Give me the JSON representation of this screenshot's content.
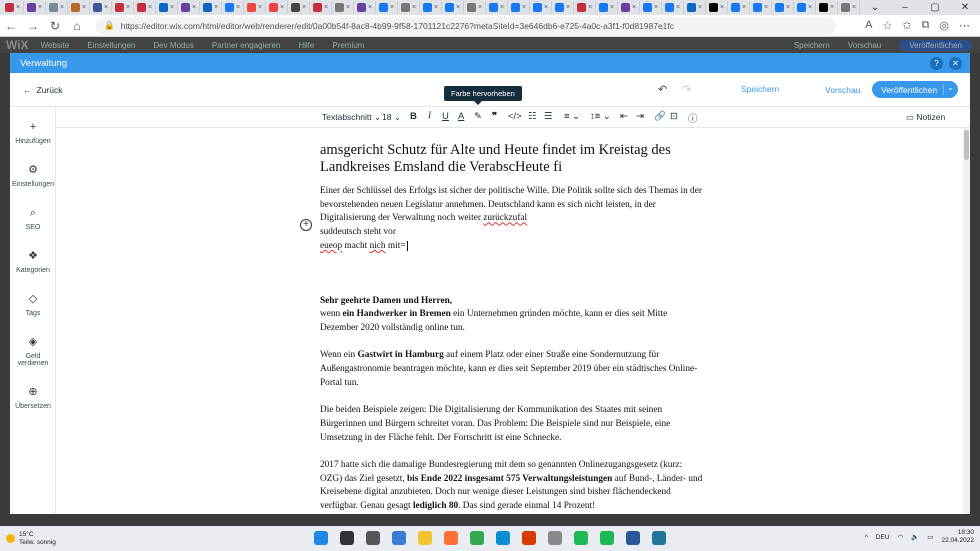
{
  "browser": {
    "tabs": [
      {
        "color": "#c72c41"
      },
      {
        "color": "#6b3fa0"
      },
      {
        "color": "#7a8a99"
      },
      {
        "color": "#b56a2a"
      },
      {
        "color": "#3b5998"
      },
      {
        "color": "#c72c41"
      },
      {
        "color": "#c72c41"
      },
      {
        "color": "#0a66c2"
      },
      {
        "color": "#6b3fa0"
      },
      {
        "color": "#0a66c2"
      },
      {
        "color": "#1877f2"
      },
      {
        "color": "#e44"
      },
      {
        "color": "#e44"
      },
      {
        "color": "#444"
      },
      {
        "color": "#c72c41"
      },
      {
        "color": "#777"
      },
      {
        "color": "#6b3fa0"
      },
      {
        "color": "#1877f2"
      },
      {
        "color": "#777"
      },
      {
        "color": "#1877f2"
      },
      {
        "color": "#1877f2"
      },
      {
        "color": "#777"
      },
      {
        "color": "#1877f2"
      },
      {
        "color": "#1877f2"
      },
      {
        "color": "#1877f2"
      },
      {
        "color": "#1877f2"
      },
      {
        "color": "#c72c41"
      },
      {
        "color": "#1877f2"
      },
      {
        "color": "#6b3fa0"
      },
      {
        "color": "#1877f2"
      },
      {
        "color": "#1877f2"
      },
      {
        "color": "#0a66c2"
      },
      {
        "color": "#000000"
      },
      {
        "color": "#1877f2"
      },
      {
        "color": "#1877f2"
      },
      {
        "color": "#1877f2"
      },
      {
        "color": "#1877f2"
      },
      {
        "color": "#000000"
      },
      {
        "color": "#777"
      },
      {
        "color": "#0a66c2"
      }
    ],
    "active_tab_label": "V",
    "url": "https://editor.wix.com/html/editor/web/renderer/edit/0a00b54f-8ac8-4b99-9f58-1701121c2276?metaSiteId=3e646db6-e725-4a0c-a3f1-f0d81987e1fc"
  },
  "wix_header": {
    "logo": "WiX",
    "menu": [
      "Website",
      "Einstellungen",
      "Dev Modus",
      "Partner engagieren",
      "Hilfe",
      "Premium"
    ],
    "right": [
      "Speichern",
      "Vorschau"
    ],
    "publish": "Veröffentlichen"
  },
  "modal": {
    "title": "Verwaltung",
    "back_label": "Zurück",
    "save_label": "Speichern",
    "preview_label": "Vorschau",
    "publish_label": "Veröffentlichen"
  },
  "sidebar": {
    "items": [
      {
        "label": "Hinzufügen",
        "icon": "plus-icon"
      },
      {
        "label": "Einstellungen",
        "icon": "gear-icon"
      },
      {
        "label": "SEO",
        "icon": "search-icon"
      },
      {
        "label": "Kategorien",
        "icon": "categories-icon"
      },
      {
        "label": "Tags",
        "icon": "tag-icon"
      },
      {
        "label": "Geld verdienen",
        "icon": "money-icon"
      },
      {
        "label": "Übersetzen",
        "icon": "globe-icon"
      }
    ]
  },
  "toolbar": {
    "paragraph_style": "Textabschnitt",
    "font_size": "18",
    "notes_label": "Notizen",
    "tooltip": "Farbe hervorheben"
  },
  "document": {
    "heading": "amsgericht  Schutz für Alte und Heute findet im Kreistag des Landkreises Emsland die VerabscHeute fi",
    "p1_a": "Einer der Schlüssel des Erfolgs ist sicher der politische Wille. Die Politik sollte sich des Themas in der bevorstehenden neuen Legislatur annehmen. Deutschland kann es sich nicht leisten, in der Digitalisierung der Verwaltung noch weiter ",
    "p1_misspelled": "zurückzufal",
    "line2": "suddeutsch steht vor",
    "line3_a": "eueop",
    "line3_b": " macht ",
    "line3_c": "nich",
    "line3_d": " mit=",
    "p2_bold": "Sehr geehrte Damen und Herren,",
    "p2_a": "wenn ",
    "p2_bold2": "ein Handwerker in Bremen",
    "p2_b": " ein Unternehmen gründen möchte, kann er dies seit Mitte Dezember 2020 vollständig online tun.",
    "p3_a": "Wenn ein ",
    "p3_bold": "Gastwirt in Hamburg",
    "p3_b": " auf einem Platz oder einer Straße eine Sondernutzung für Außengastronomie beantragen möchte, kann er dies seit September 2019 über ein städtisches Online-Portal tun.",
    "p4": "Die beiden Beispiele zeigen: Die Digitalisierung der Kommunikation des Staates mit seinen Bürgerinnen und Bürgern schreitet voran. Das Problem: Die Beispiele sind nur Beispiele, eine Umsetzung in der Fläche fehlt. Der Fortschritt ist eine Schnecke.",
    "p5_a": "2017 hatte sich die damalige Bundesregierung mit dem so genannten Onlinezugangsgesetz (kurz: OZG) das Ziel gesetzt, ",
    "p5_bold": "bis Ende 2022 insgesamt 575 Verwaltungsleistungen",
    "p5_b": " auf Bund-, Länder- und Kreisebene digital anzubieten. Doch nur wenige dieser Leistungen sind bisher flächendeckend verfügbar. Genau gesagt ",
    "p5_bold2": "lediglich 80",
    "p5_c": ". Das sind gerade einmal 14 Prozent!"
  },
  "taskbar": {
    "temperature": "15°C",
    "weather": "Teilw. sonnig",
    "language": "DEU",
    "time": "18:30",
    "date": "22.04.2022",
    "apps": [
      {
        "name": "windows-icon",
        "color": "#1e88e5"
      },
      {
        "name": "search-icon",
        "color": "#333"
      },
      {
        "name": "task-view-icon",
        "color": "#555"
      },
      {
        "name": "widgets-icon",
        "color": "#3a7bd5"
      },
      {
        "name": "explorer-icon",
        "color": "#f4c430"
      },
      {
        "name": "firefox-icon",
        "color": "#ff7139"
      },
      {
        "name": "chrome-icon",
        "color": "#34a853"
      },
      {
        "name": "edge-icon",
        "color": "#0c8fd0"
      },
      {
        "name": "office-icon",
        "color": "#d83b01"
      },
      {
        "name": "photos-icon",
        "color": "#888"
      },
      {
        "name": "spotify-icon",
        "color": "#1db954"
      },
      {
        "name": "spotify-2-icon",
        "color": "#1db954"
      },
      {
        "name": "word-icon",
        "color": "#2b579a"
      },
      {
        "name": "wordpress-icon",
        "color": "#21759b"
      }
    ]
  }
}
